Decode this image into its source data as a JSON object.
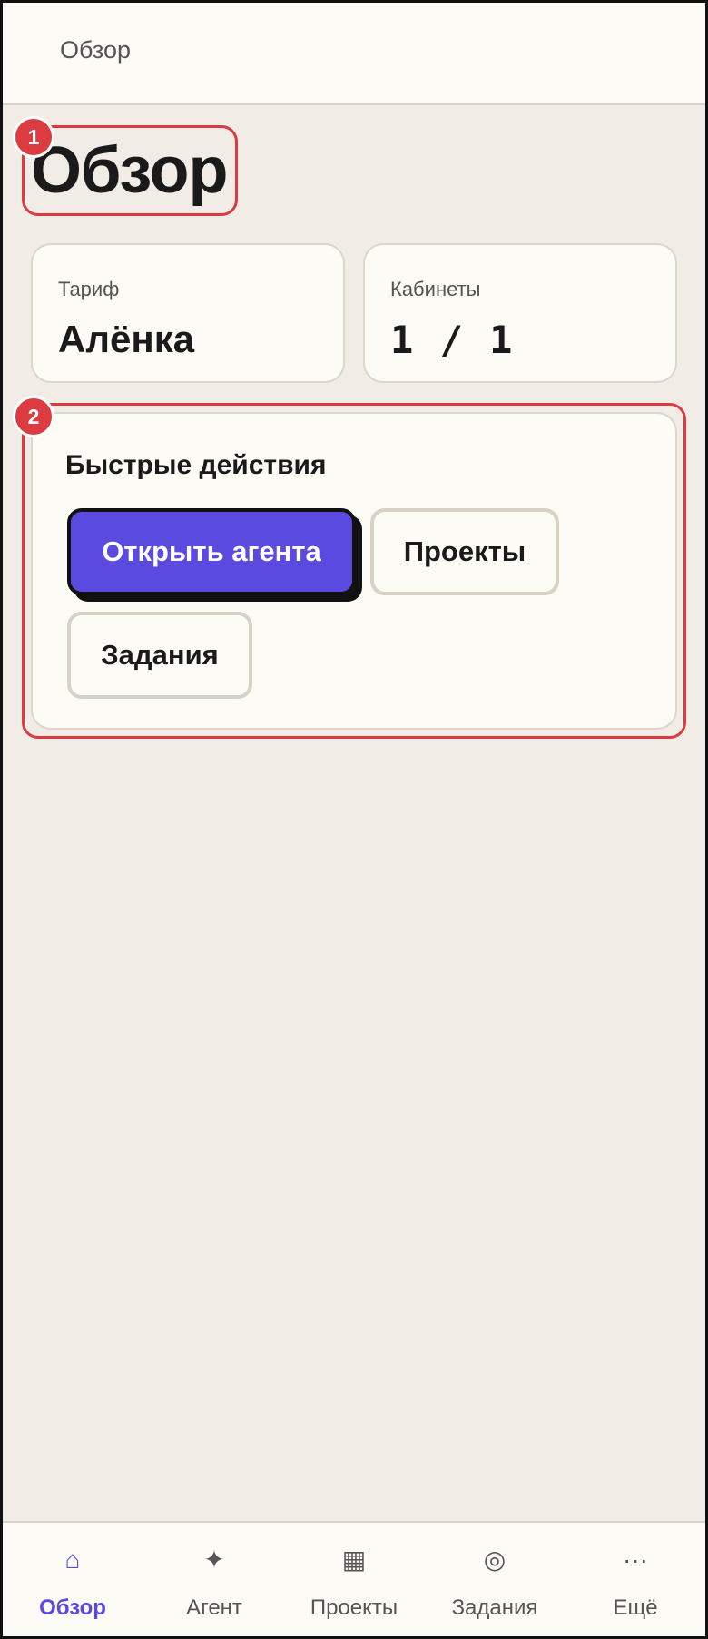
{
  "topbar": {
    "title": "Обзор"
  },
  "page": {
    "title": "Обзор"
  },
  "annotations": {
    "badge1": "1",
    "badge2": "2"
  },
  "stats": {
    "plan": {
      "label": "Тариф",
      "value": "Алёнка"
    },
    "cabinets": {
      "label": "Кабинеты",
      "value": "1 / 1"
    }
  },
  "quick_actions": {
    "title": "Быстрые действия",
    "open_agent": "Открыть агента",
    "projects": "Проекты",
    "tasks": "Задания"
  },
  "nav": {
    "items": [
      {
        "icon": "⌂",
        "icon_name": "home-icon",
        "label": "Обзор",
        "active": true
      },
      {
        "icon": "✦",
        "icon_name": "sparkle-icon",
        "label": "Агент",
        "active": false
      },
      {
        "icon": "▦",
        "icon_name": "grid-icon",
        "label": "Проекты",
        "active": false
      },
      {
        "icon": "◎",
        "icon_name": "target-icon",
        "label": "Задания",
        "active": false
      },
      {
        "icon": "···",
        "icon_name": "more-icon",
        "label": "Ещё",
        "active": false
      }
    ]
  },
  "colors": {
    "accent": "#5a4ae0",
    "annotation": "#dc3b3f",
    "background": "#f1ece5",
    "surface": "#fdfbf6"
  }
}
